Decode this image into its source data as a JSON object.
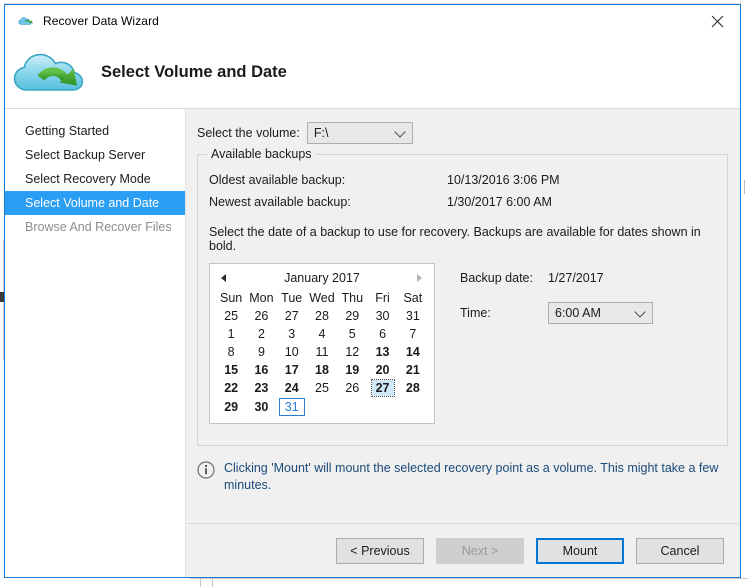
{
  "window": {
    "title": "Recover Data Wizard",
    "title_icon": "cloud-restore-icon",
    "close_icon": "close-icon",
    "border_color": "#1a7fd4"
  },
  "header": {
    "logo_icon": "cloud-restore-logo",
    "title": "Select Volume and Date"
  },
  "sidebar": {
    "items": [
      {
        "label": "Getting Started",
        "state": "normal"
      },
      {
        "label": "Select Backup Server",
        "state": "normal"
      },
      {
        "label": "Select Recovery Mode",
        "state": "normal"
      },
      {
        "label": "Select Volume and Date",
        "state": "selected"
      },
      {
        "label": "Browse And Recover Files",
        "state": "disabled"
      }
    ],
    "selected_color": "#2a9df4"
  },
  "volume": {
    "label": "Select the volume:",
    "value": "F:\\",
    "dropdown_icon": "chevron-down-icon"
  },
  "available_backups": {
    "legend": "Available backups",
    "oldest_label": "Oldest available backup:",
    "oldest_value": "10/13/2016 3:06 PM",
    "newest_label": "Newest available backup:",
    "newest_value": "1/30/2017 6:00 AM",
    "instruction": "Select the date of a backup to use for recovery. Backups are available for dates shown in bold."
  },
  "calendar": {
    "title": "January 2017",
    "prev_icon": "triangle-left-icon",
    "next_icon": "triangle-right-icon",
    "prev_enabled": true,
    "next_enabled": false,
    "weekdays": [
      "Sun",
      "Mon",
      "Tue",
      "Wed",
      "Thu",
      "Fri",
      "Sat"
    ],
    "weeks": [
      [
        {
          "d": "25",
          "m": "other"
        },
        {
          "d": "26",
          "m": "other"
        },
        {
          "d": "27",
          "m": "other"
        },
        {
          "d": "28",
          "m": "other"
        },
        {
          "d": "29",
          "m": "other"
        },
        {
          "d": "30",
          "m": "other"
        },
        {
          "d": "31",
          "m": "other"
        }
      ],
      [
        {
          "d": "1",
          "m": "cur"
        },
        {
          "d": "2",
          "m": "cur"
        },
        {
          "d": "3",
          "m": "cur"
        },
        {
          "d": "4",
          "m": "cur"
        },
        {
          "d": "5",
          "m": "cur"
        },
        {
          "d": "6",
          "m": "cur"
        },
        {
          "d": "7",
          "m": "cur"
        }
      ],
      [
        {
          "d": "8",
          "m": "cur"
        },
        {
          "d": "9",
          "m": "cur"
        },
        {
          "d": "10",
          "m": "cur"
        },
        {
          "d": "11",
          "m": "cur"
        },
        {
          "d": "12",
          "m": "cur"
        },
        {
          "d": "13",
          "m": "cur",
          "bold": true
        },
        {
          "d": "14",
          "m": "cur",
          "bold": true
        }
      ],
      [
        {
          "d": "15",
          "m": "cur",
          "bold": true
        },
        {
          "d": "16",
          "m": "cur",
          "bold": true
        },
        {
          "d": "17",
          "m": "cur",
          "bold": true
        },
        {
          "d": "18",
          "m": "cur",
          "bold": true
        },
        {
          "d": "19",
          "m": "cur",
          "bold": true
        },
        {
          "d": "20",
          "m": "cur",
          "bold": true
        },
        {
          "d": "21",
          "m": "cur",
          "bold": true
        }
      ],
      [
        {
          "d": "22",
          "m": "cur",
          "bold": true
        },
        {
          "d": "23",
          "m": "cur",
          "bold": true
        },
        {
          "d": "24",
          "m": "cur",
          "bold": true
        },
        {
          "d": "25",
          "m": "cur"
        },
        {
          "d": "26",
          "m": "cur"
        },
        {
          "d": "27",
          "m": "cur",
          "bold": true,
          "selected": true
        },
        {
          "d": "28",
          "m": "cur",
          "bold": true
        }
      ],
      [
        {
          "d": "29",
          "m": "cur",
          "bold": true
        },
        {
          "d": "30",
          "m": "cur",
          "bold": true
        },
        {
          "d": "31",
          "m": "cur",
          "today": true
        },
        {
          "d": "",
          "m": "empty"
        },
        {
          "d": "",
          "m": "empty"
        },
        {
          "d": "",
          "m": "empty"
        },
        {
          "d": "",
          "m": "empty"
        }
      ]
    ],
    "selected_date": "27",
    "today_date": "31"
  },
  "picker": {
    "backup_date_label": "Backup date:",
    "backup_date_value": "1/27/2017",
    "time_label": "Time:",
    "time_value": "6:00 AM",
    "time_dropdown_icon": "chevron-down-icon"
  },
  "info": {
    "icon": "info-icon",
    "text": "Clicking 'Mount' will mount the selected recovery point as a volume. This might take a few minutes."
  },
  "footer": {
    "previous_label": "< Previous",
    "next_label": "Next >",
    "next_enabled": false,
    "mount_label": "Mount",
    "mount_is_default": true,
    "cancel_label": "Cancel",
    "default_button_color": "#0078d7"
  }
}
